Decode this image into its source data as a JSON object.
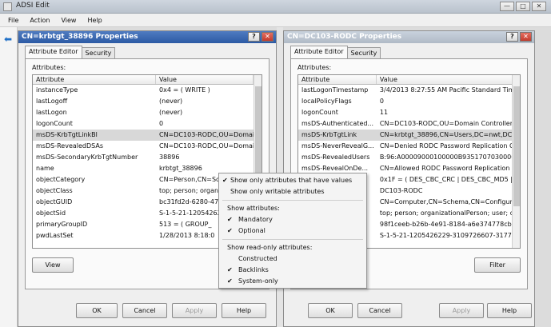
{
  "window": {
    "title": "ADSI Edit",
    "min": "—",
    "max": "□",
    "close": "✕"
  },
  "menu": [
    "File",
    "Action",
    "View",
    "Help"
  ],
  "dialog1": {
    "title": "CN=krbtgt_38896 Properties",
    "help_btn": "?",
    "close_btn": "✕",
    "tabs": [
      "Attribute Editor",
      "Security"
    ],
    "attributes_label": "Attributes:",
    "columns": [
      "Attribute",
      "Value"
    ],
    "rows": [
      [
        "instanceType",
        "0x4 = ( WRITE )"
      ],
      [
        "lastLogoff",
        "(never)"
      ],
      [
        "lastLogon",
        "(never)"
      ],
      [
        "logonCount",
        "0"
      ],
      [
        "msDS-KrbTgtLinkBl",
        "CN=DC103-RODC,OU=Domai"
      ],
      [
        "msDS-RevealedDSAs",
        "CN=DC103-RODC,OU=Domai"
      ],
      [
        "msDS-SecondaryKrbTgtNumber",
        "38896"
      ],
      [
        "name",
        "krbtgt_38896"
      ],
      [
        "objectCategory",
        "CN=Person,CN=Sc"
      ],
      [
        "objectClass",
        "top; person; organ"
      ],
      [
        "objectGUID",
        "bc31fd2d-6280-47"
      ],
      [
        "objectSid",
        "S-1-5-21-12054262"
      ],
      [
        "primaryGroupID",
        "513 = ( GROUP_"
      ],
      [
        "pwdLastSet",
        "1/28/2013 8:18:0"
      ]
    ],
    "view_btn": "View",
    "buttons": [
      "OK",
      "Cancel",
      "Apply",
      "Help"
    ]
  },
  "dialog2": {
    "title": "CN=DC103-RODC Properties",
    "help_btn": "?",
    "close_btn": "✕",
    "tabs": [
      "Attribute Editor",
      "Security"
    ],
    "attributes_label": "Attributes:",
    "columns": [
      "Attribute",
      "Value"
    ],
    "rows": [
      [
        "lastLogonTimestamp",
        "3/4/2013 8:27:55 AM Pacific Standard Time"
      ],
      [
        "localPolicyFlags",
        "0"
      ],
      [
        "logonCount",
        "11"
      ],
      [
        "msDS-Authenticated...",
        "CN=DC103-RODC,OU=Domain Controllers,D"
      ],
      [
        "msDS-KrbTgtLink",
        "CN=krbtgt_38896,CN=Users,DC=nwt,DC=co"
      ],
      [
        "msDS-NeverRevealG...",
        "CN=Denied RODC Password Replication Gro"
      ],
      [
        "msDS-RevealedUsers",
        "B:96:A00009000100000B9351707030000"
      ],
      [
        "msDS-RevealOnDe...",
        "CN=Allowed RODC Password Replication Gr"
      ],
      [
        "",
        "0x1F = ( DES_CBC_CRC | DES_CBC_MD5 |"
      ],
      [
        "",
        "DC103-RODC"
      ],
      [
        "",
        "CN=Computer,CN=Schema,CN=Configuration"
      ],
      [
        "",
        "top; person; organizationalPerson; user; com"
      ],
      [
        "",
        "98f1ceeb-b26b-4e91-8184-a6e374778cb6"
      ],
      [
        "",
        "S-1-5-21-1205426229-3109726607-3177233"
      ]
    ],
    "filter_btn": "Filter",
    "buttons": [
      "OK",
      "Cancel",
      "Apply",
      "Help"
    ]
  },
  "context_menu": {
    "show_values": "Show only attributes that have values",
    "show_writable": "Show only writable attributes",
    "show_attrs_header": "Show attributes:",
    "mandatory": "Mandatory",
    "optional": "Optional",
    "show_readonly_header": "Show read-only attributes:",
    "constructed": "Constructed",
    "backlinks": "Backlinks",
    "system_only": "System-only",
    "check": "✔"
  }
}
